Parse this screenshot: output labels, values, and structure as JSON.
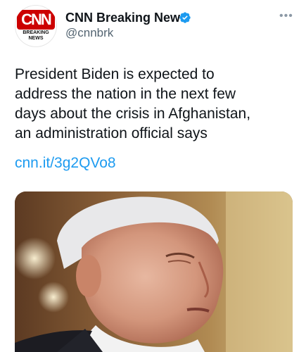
{
  "account": {
    "logo_text": "CNN",
    "logo_subtext": "BREAKING NEWS",
    "display_name": "CNN Breaking News",
    "handle": "@cnnbrk",
    "verified": true
  },
  "tweet": {
    "text": "President Biden is expected to\naddress the nation in the next few\ndays about the crisis in Afghanistan,\nan administration official says",
    "link": "cnn.it/3g2QVo8"
  },
  "media": {
    "description": "Photo of a man in a dark suit"
  },
  "colors": {
    "brand": "#cc0000",
    "link": "#1d9bf0",
    "verified": "#1d9bf0"
  }
}
